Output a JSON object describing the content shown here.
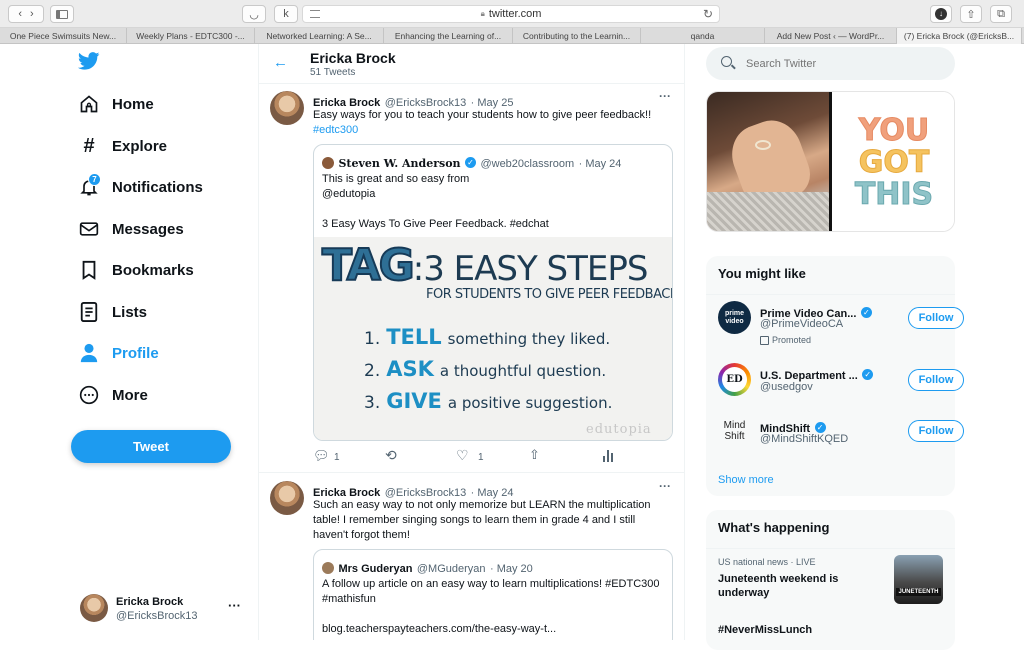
{
  "browser": {
    "url": "twitter.com",
    "tabs": [
      "One Piece Swimsuits New...",
      "Weekly Plans - EDTC300 -...",
      "Networked Learning: A Se...",
      "Enhancing the Learning of...",
      "Contributing to the Learnin...",
      "qanda",
      "Add New Post ‹ — WordPr...",
      "(7) Ericka Brock (@EricksB..."
    ],
    "active_tab": 7
  },
  "nav": {
    "items": [
      {
        "label": "Home",
        "icon": "home-icon"
      },
      {
        "label": "Explore",
        "icon": "hashtag-icon"
      },
      {
        "label": "Notifications",
        "icon": "bell-icon",
        "badge": "7"
      },
      {
        "label": "Messages",
        "icon": "envelope-icon"
      },
      {
        "label": "Bookmarks",
        "icon": "bookmark-icon"
      },
      {
        "label": "Lists",
        "icon": "list-icon"
      },
      {
        "label": "Profile",
        "icon": "person-icon",
        "active": true
      },
      {
        "label": "More",
        "icon": "more-icon"
      }
    ],
    "tweet_button": "Tweet",
    "account": {
      "name": "Ericka Brock",
      "handle": "@EricksBrock13"
    }
  },
  "profile_header": {
    "name": "Ericka Brock",
    "count": "51 Tweets"
  },
  "tweets": [
    {
      "name": "Ericka Brock",
      "handle": "@EricksBrock13",
      "date": "· May 25",
      "text": "Easy ways for you to teach your students how to give peer feedback!!",
      "hashtag": "#edtc300",
      "quote": {
        "name": "Steven W. Anderson",
        "handle": "@web20classroom",
        "date": "· May 24",
        "text_lines": [
          "This is great and so easy from",
          "@edutopia",
          "",
          "3 Easy Ways To Give Peer Feedback. #edchat"
        ],
        "image": {
          "title_tag": "TAG",
          "title_rest": ":3 EASY STEPS",
          "subtitle": "FOR STUDENTS TO GIVE PEER FEEDBACK",
          "steps": [
            {
              "num": "1.",
              "word": "TELL",
              "rest": "something they liked."
            },
            {
              "num": "2.",
              "word": "ASK",
              "rest": "a thoughtful question."
            },
            {
              "num": "3.",
              "word": "GIVE",
              "rest": "a positive suggestion."
            }
          ],
          "watermark": "edutopia"
        }
      },
      "actions": {
        "replies": "1",
        "retweets": "",
        "likes": "1"
      }
    },
    {
      "name": "Ericka Brock",
      "handle": "@EricksBrock13",
      "date": "· May 24",
      "text": "Such an easy way to not only memorize but LEARN the multiplication table! I remember singing songs to learn them in grade 4 and I still haven't forgot them!",
      "quote": {
        "name": "Mrs Guderyan",
        "handle": "@MGuderyan",
        "date": "· May 20",
        "text_lines": [
          "A follow up article on an easy way to learn multiplications! #EDTC300",
          "#mathisfun",
          "",
          "blog.teacherspayteachers.com/the-easy-way-t..."
        ]
      }
    }
  ],
  "search": {
    "placeholder": "Search Twitter"
  },
  "media": {
    "sticker": [
      "YOU",
      "GOT",
      "THIS"
    ]
  },
  "you_might_like": {
    "title": "You might like",
    "accounts": [
      {
        "name": "Prime Video Can...",
        "handle": "@PrimeVideoCA",
        "promoted": "Promoted",
        "follow": "Follow",
        "avatar_text": "prime video"
      },
      {
        "name": "U.S. Department ...",
        "handle": "@usedgov",
        "follow": "Follow",
        "avatar_text": "ED"
      },
      {
        "name": "MindShift",
        "handle": "@MindShiftKQED",
        "follow": "Follow",
        "avatar_text": "Mind Shift"
      }
    ],
    "show_more": "Show more"
  },
  "whats_happening": {
    "title": "What's happening",
    "items": [
      {
        "meta": "US national news · LIVE",
        "headline": "Juneteenth weekend is underway",
        "thumb_text": "JUNETEENTH"
      }
    ],
    "next": "#NeverMissLunch"
  },
  "colors": {
    "accent": "#1d9bf0",
    "text": "#0f1419",
    "muted": "#536471"
  }
}
